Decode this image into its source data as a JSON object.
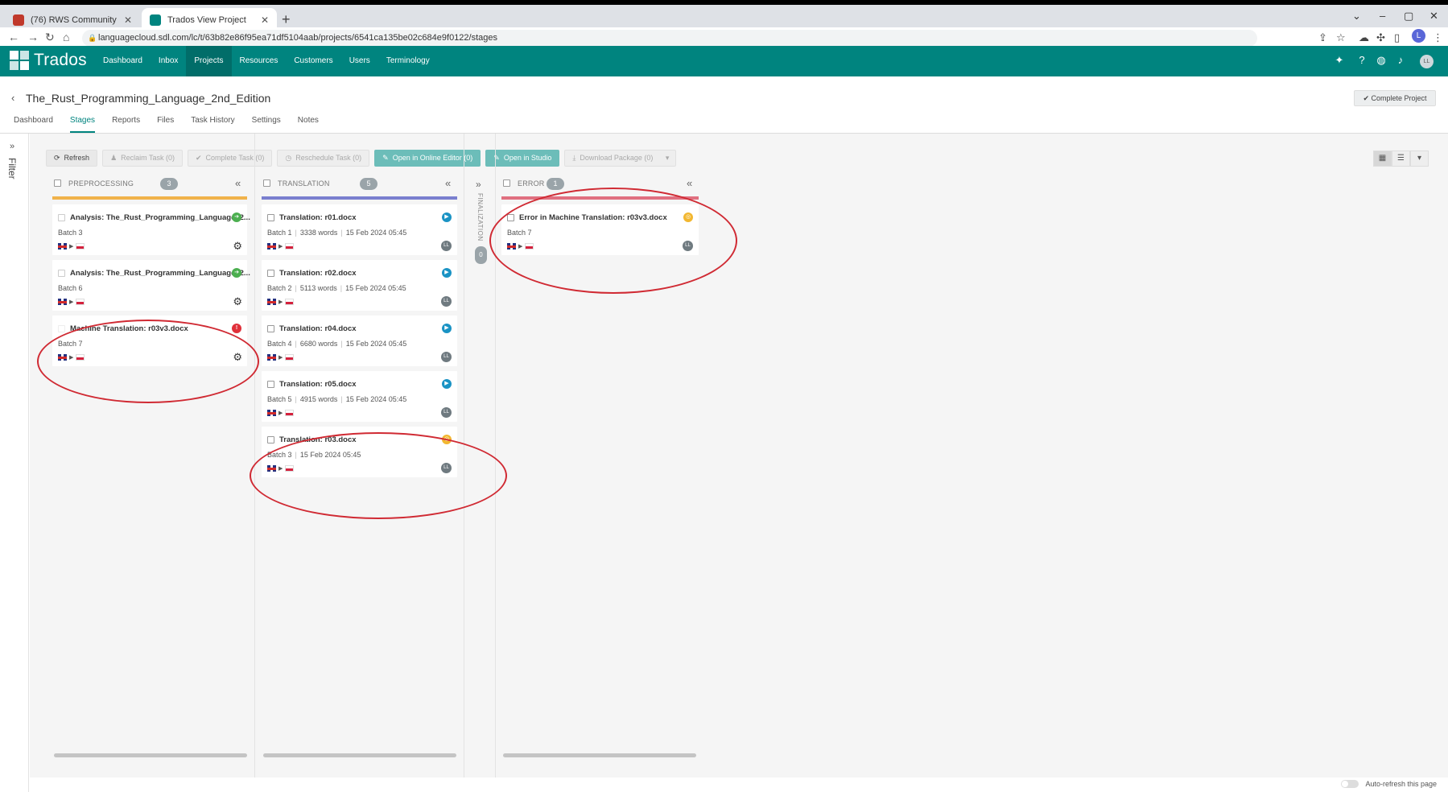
{
  "browser": {
    "tabs": [
      {
        "title": "(76) RWS Community"
      },
      {
        "title": "Trados View Project"
      }
    ],
    "url": "languagecloud.sdl.com/lc/t/63b82e86f95ea71df5104aab/projects/6541ca135be02c684e9f0122/stages",
    "profile_initial": "L"
  },
  "app": {
    "brand": "Trados",
    "nav": [
      "Dashboard",
      "Inbox",
      "Projects",
      "Resources",
      "Customers",
      "Users",
      "Terminology"
    ],
    "active_nav": "Projects",
    "user_initials": "LL"
  },
  "project": {
    "title": "The_Rust_Programming_Language_2nd_Edition",
    "complete_button": "Complete Project",
    "tabs": [
      "Dashboard",
      "Stages",
      "Reports",
      "Files",
      "Task History",
      "Settings",
      "Notes"
    ],
    "active_tab": "Stages"
  },
  "filter_label": "Filter",
  "toolbar": {
    "refresh": "Refresh",
    "reclaim": "Reclaim Task (0)",
    "complete": "Complete Task (0)",
    "reschedule": "Reschedule Task (0)",
    "online_editor": "Open in Online Editor (0)",
    "studio": "Open in Studio",
    "download": "Download Package (0)"
  },
  "colors": {
    "brand": "#00847f",
    "preprocessing": "#f0b24a",
    "translation": "#7a7fcf",
    "error": "#e07080",
    "annotation": "#d02a33"
  },
  "columns": {
    "preprocessing": {
      "name": "PREPROCESSING",
      "count": "3",
      "cards": [
        {
          "title": "Analysis: The_Rust_Programming_Language_2...",
          "batch": "Batch 3",
          "status": "forward-icon"
        },
        {
          "title": "Analysis: The_Rust_Programming_Language_2...",
          "batch": "Batch 6",
          "status": "forward-icon"
        },
        {
          "title": "Machine Translation: r03v3.docx",
          "batch": "Batch 7",
          "status": "error-icon"
        }
      ]
    },
    "translation": {
      "name": "TRANSLATION",
      "count": "5",
      "cards": [
        {
          "title": "Translation: r01.docx",
          "batch": "Batch 1",
          "words": "3338 words",
          "date": "15 Feb 2024 05:45"
        },
        {
          "title": "Translation: r02.docx",
          "batch": "Batch 2",
          "words": "5113 words",
          "date": "15 Feb 2024 05:45"
        },
        {
          "title": "Translation: r04.docx",
          "batch": "Batch 4",
          "words": "6680 words",
          "date": "15 Feb 2024 05:45"
        },
        {
          "title": "Translation: r05.docx",
          "batch": "Batch 5",
          "words": "4915 words",
          "date": "15 Feb 2024 05:45"
        },
        {
          "title": "Translation: r03.docx",
          "batch": "Batch 3",
          "date": "15 Feb 2024 05:45"
        }
      ]
    },
    "finalization": {
      "name": "FINALIZATION",
      "count": "0"
    },
    "error": {
      "name": "ERROR",
      "count": "1",
      "cards": [
        {
          "title": "Error in Machine Translation: r03v3.docx",
          "batch": "Batch 7"
        }
      ]
    }
  },
  "footer": {
    "auto_refresh": "Auto-refresh this page"
  }
}
